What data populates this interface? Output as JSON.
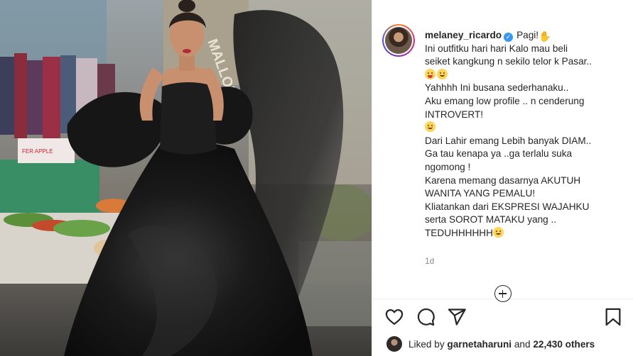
{
  "post": {
    "username": "melaney_ricardo",
    "verified_icon": "verified-badge-icon",
    "caption_first": "Pagi!",
    "caption_lines": [
      "Ini outfitku hari hari Kalo mau beli",
      "seiket kangkung n sekilo telor k Pasar..",
      "Yahhhh Ini busana sederhanaku..",
      "Aku emang low profile .. n cenderung",
      "INTROVERT!",
      "Dari Lahir emang Lebih banyak DIAM..",
      "Ga tau kenapa ya ..ga terlalu suka",
      "ngomong !",
      "Karena memang dasarnya AKUTUH",
      "WANITA YANG PEMALU!",
      "Kliatankan dari EKSPRESI WAJAHKU",
      "serta SOROT MATAKU yang ..",
      "TEDUHHHHHH"
    ],
    "timestamp": "1d"
  },
  "photo": {
    "sign_text": "MALLONG",
    "sign_text_2": "FER APPLE",
    "palette": {
      "dress": "#141414",
      "skin": "#c8906e",
      "wall": "#8a8577"
    }
  },
  "actions": {
    "like_icon": "heart-icon",
    "comment_icon": "comment-icon",
    "share_icon": "paper-plane-icon",
    "save_icon": "bookmark-icon",
    "load_more_icon": "plus-circle-icon"
  },
  "likes": {
    "prefix": "Liked by",
    "user": "garnetaharuni",
    "middle": "and",
    "others": "22,430 others"
  },
  "colors": {
    "text": "#262626",
    "muted": "#8e8e8e",
    "verified": "#3897f0",
    "border": "#efefef"
  }
}
